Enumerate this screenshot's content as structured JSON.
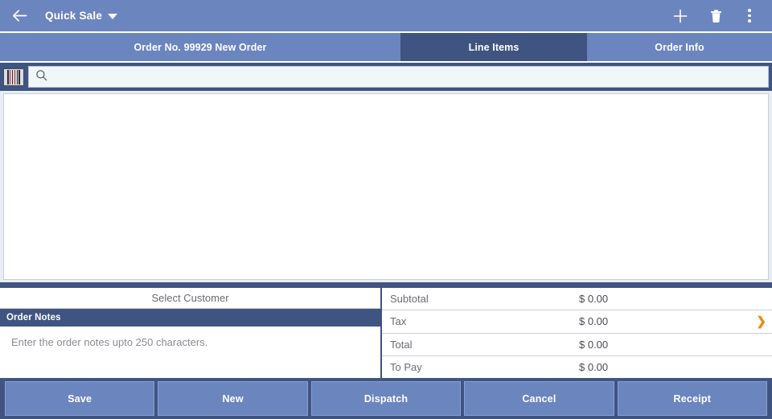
{
  "appbar": {
    "back_icon": "back-arrow-icon",
    "title": "Quick Sale",
    "dropdown_icon": "chevron-down-icon",
    "add_icon": "plus-icon",
    "delete_icon": "trash-icon",
    "overflow_icon": "more-vertical-icon"
  },
  "tabs": [
    {
      "label": "Order No. 99929 New Order",
      "active": false,
      "name": "tab-order-no"
    },
    {
      "label": "Line Items",
      "active": true,
      "name": "tab-line-items"
    },
    {
      "label": "Order Info",
      "active": false,
      "name": "tab-order-info"
    }
  ],
  "search": {
    "barcode_icon": "barcode-scan-icon",
    "search_icon": "search-icon",
    "value": "",
    "placeholder": ""
  },
  "line_items": {
    "rows": [],
    "empty": true
  },
  "customer": {
    "select_label": "Select Customer"
  },
  "notes": {
    "header": "Order Notes",
    "value": "",
    "placeholder": "Enter the order notes upto 250 characters."
  },
  "totals": [
    {
      "label": "Subtotal",
      "value": "$ 0.00",
      "chevron": false
    },
    {
      "label": "Tax",
      "value": "$ 0.00",
      "chevron": true
    },
    {
      "label": "Total",
      "value": "$ 0.00",
      "chevron": false
    },
    {
      "label": "To Pay",
      "value": "$ 0.00",
      "chevron": false
    }
  ],
  "chevron_glyph": "❯",
  "buttons": [
    {
      "label": "Save",
      "name": "save-button"
    },
    {
      "label": "New",
      "name": "new-button"
    },
    {
      "label": "Dispatch",
      "name": "dispatch-button"
    },
    {
      "label": "Cancel",
      "name": "cancel-button"
    },
    {
      "label": "Receipt",
      "name": "receipt-button"
    }
  ],
  "colors": {
    "primary": "#6b85bf",
    "dark": "#3f5480",
    "accent_orange": "#f0861a",
    "field_bg": "#f0f7fa",
    "page_bg": "#e9eef5"
  }
}
